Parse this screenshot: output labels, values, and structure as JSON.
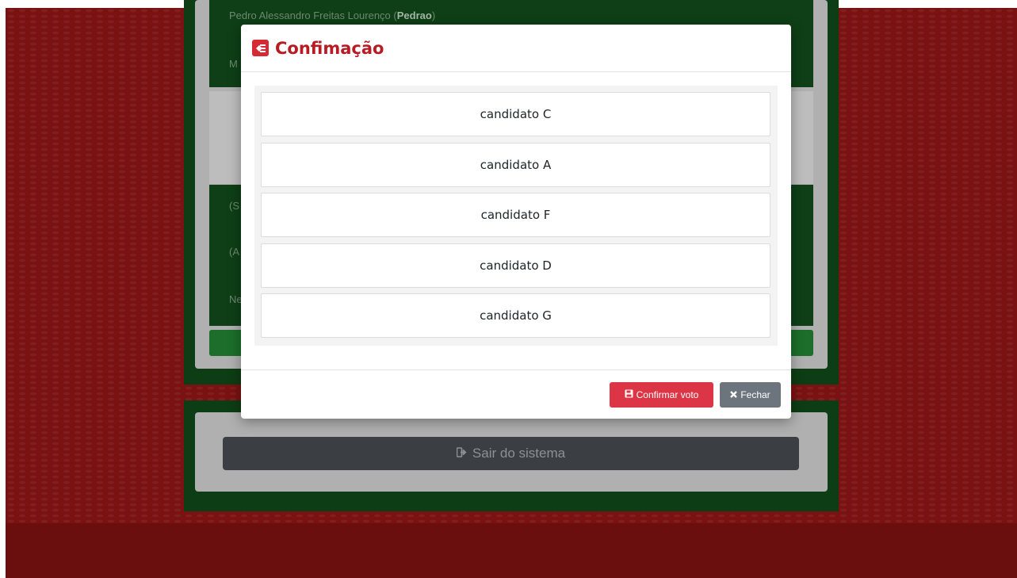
{
  "background": {
    "header_text_normal": "Pedro Alessandro Freitas Lourenço (",
    "header_text_bold": "Pedrao",
    "header_text_end": ")",
    "row_fragments": [
      "M",
      "(S",
      "(A",
      "Ne"
    ],
    "logout_label": "Sair do sistema"
  },
  "modal": {
    "title": "Confimação",
    "candidates": [
      "candidato C",
      "candidato A",
      "candidato F",
      "candidato D",
      "candidato G"
    ],
    "confirm_label": "Confirmar voto",
    "close_label": "Fechar"
  },
  "colors": {
    "background_red": "#7a1212",
    "panel_green": "#0d3d14",
    "title_red": "#b71c25",
    "confirm_button": "#dc3545",
    "close_button": "#6c757d",
    "logout_button": "#3b3f44"
  },
  "icons": {
    "title": "vote-hand-icon",
    "confirm": "save-icon",
    "close": "times-icon",
    "logout": "sign-out-icon"
  }
}
